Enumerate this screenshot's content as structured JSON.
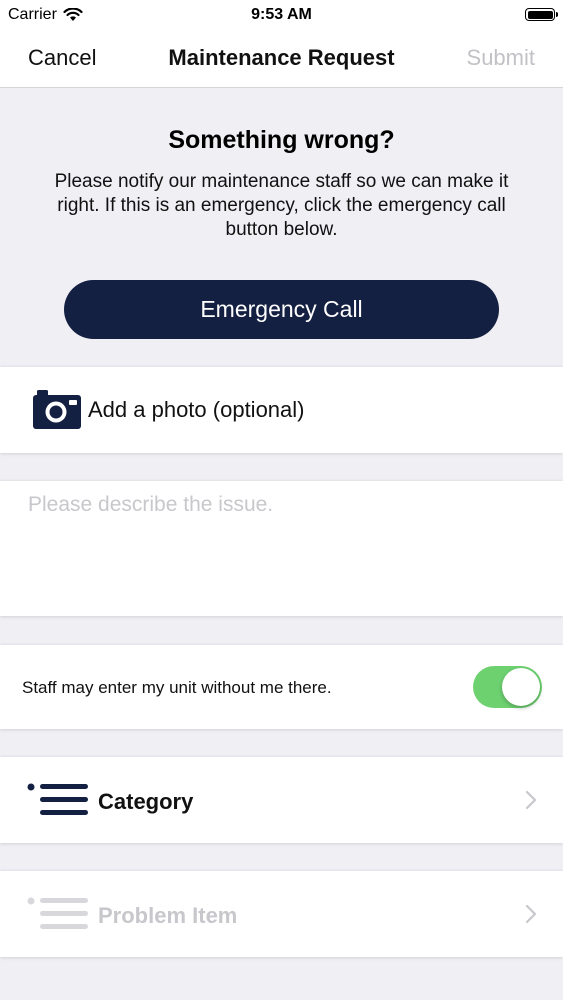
{
  "status_bar": {
    "carrier": "Carrier",
    "time": "9:53 AM"
  },
  "nav": {
    "cancel": "Cancel",
    "title": "Maintenance Request",
    "submit": "Submit"
  },
  "intro": {
    "heading": "Something wrong?",
    "body": "Please notify our maintenance staff so we can make it right. If this is an emergency, click the emergency call button below.",
    "emergency_button": "Emergency Call"
  },
  "photo": {
    "label": "Add a photo (optional)",
    "icon": "camera-icon"
  },
  "description": {
    "placeholder": "Please describe the issue.",
    "value": ""
  },
  "entry_permission": {
    "label": "Staff may enter my unit without me there.",
    "enabled": true
  },
  "category": {
    "label": "Category",
    "icon": "list-icon"
  },
  "problem_item": {
    "label": "Problem Item",
    "icon": "list-icon",
    "disabled": true
  },
  "colors": {
    "accent": "#142042",
    "toggle_on": "#6dd170",
    "disabled_text": "#c7c7cc",
    "background": "#efeff4"
  }
}
